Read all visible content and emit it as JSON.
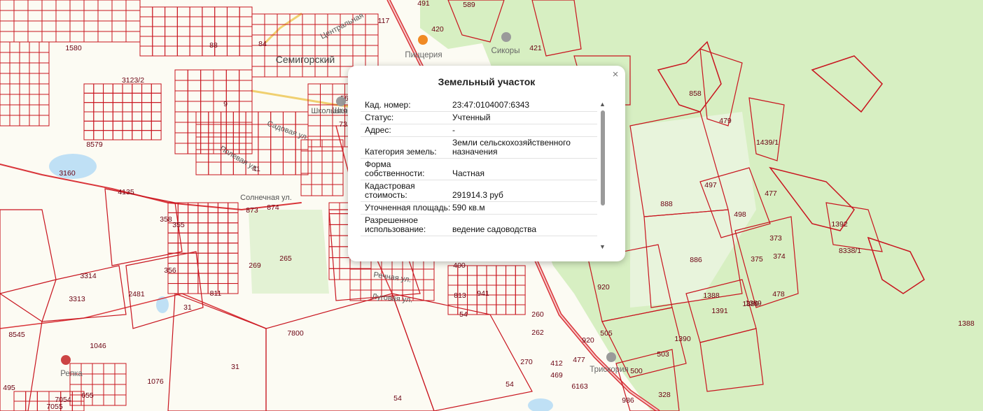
{
  "map": {
    "place_labels": [
      {
        "name": "Семигорский"
      }
    ],
    "street_labels": [
      {
        "name": "Центральная"
      },
      {
        "name": "Садовая ул."
      },
      {
        "name": "Солнечная ул."
      },
      {
        "name": "Школьная"
      },
      {
        "name": "Речная ул."
      },
      {
        "name": "Луговая ул."
      },
      {
        "name": "Полевая ул."
      }
    ],
    "poi": [
      {
        "name": "Пиццерия",
        "icon": "food-pin-icon",
        "color": "#f08a24"
      },
      {
        "name": "Сикоры",
        "icon": "building-pin-icon",
        "color": "#a0a0a0"
      },
      {
        "name": "Репка",
        "icon": "shop-pin-icon",
        "color": "#c44"
      },
      {
        "name": "Трискория",
        "icon": "cafe-pin-icon",
        "color": "#a0a0a0"
      },
      {
        "name": "Школа",
        "icon": "school-pin-icon",
        "color": "#a0a0a0"
      }
    ],
    "plot_numbers": [
      "589",
      "117",
      "491",
      "420",
      "421",
      "1580",
      "84",
      "88",
      "3123/2",
      "9",
      "56",
      "73",
      "8579",
      "41",
      "3160",
      "4135",
      "873",
      "874",
      "358",
      "355",
      "265",
      "269",
      "356",
      "3314",
      "811",
      "3313",
      "2481",
      "31",
      "8545",
      "7800",
      "1046",
      "31",
      "1076",
      "495",
      "655",
      "7054",
      "7055",
      "813",
      "941",
      "54",
      "260",
      "262",
      "270",
      "412",
      "469",
      "477",
      "6163",
      "54",
      "54",
      "920",
      "986",
      "920",
      "505",
      "1388",
      "503",
      "500",
      "328",
      "1390",
      "1389",
      "1391",
      "1388",
      "1389",
      "478",
      "886",
      "375",
      "374",
      "373",
      "498",
      "888",
      "497",
      "477",
      "1392",
      "8338/1",
      "1439/1",
      "479",
      "858",
      "400"
    ],
    "colors": {
      "background": "#fcfbf3",
      "forest": "#d7efc2",
      "field": "#e3f2d4",
      "parcel_line": "#c8141e",
      "road": "#d9353a",
      "water": "#bfe0f5"
    }
  },
  "popup": {
    "title": "Земельный участок",
    "close_glyph": "×",
    "rows": [
      {
        "key": "Кад. номер:",
        "value": "23:47:0104007:6343"
      },
      {
        "key": "Статус:",
        "value": "Учтенный"
      },
      {
        "key": "Адрес:",
        "value": "-"
      },
      {
        "key": "Категория земель:",
        "value": "Земли сельскохозяйственного назначения"
      },
      {
        "key": "Форма собственности:",
        "value": "Частная"
      },
      {
        "key": "Кадастровая стоимость:",
        "value": "291914.3 руб"
      },
      {
        "key": "Уточненная площадь:",
        "value": "590 кв.м"
      },
      {
        "key": "Разрешенное использование:",
        "value": "ведение садоводства"
      }
    ],
    "scroll_up": "▲",
    "scroll_down": "▼"
  }
}
